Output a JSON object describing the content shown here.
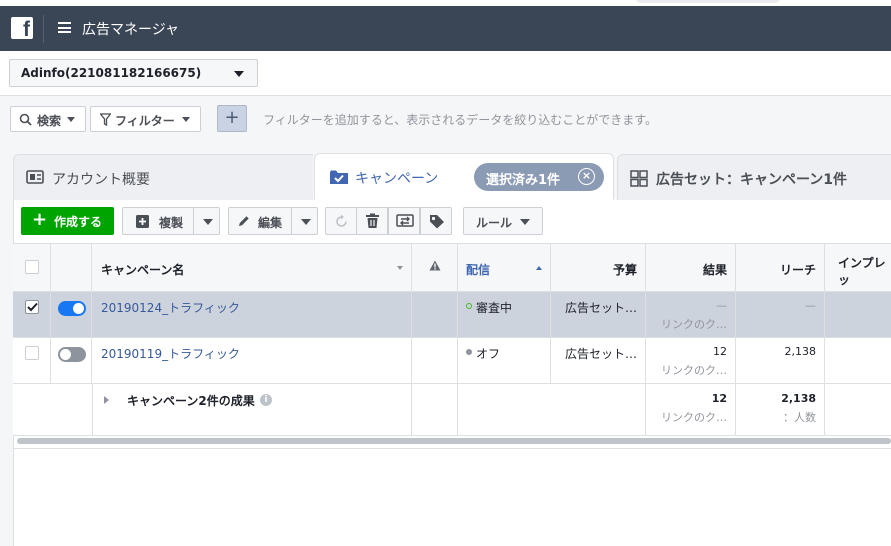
{
  "app": {
    "title": "広告マネージャ",
    "logo_letter": "f"
  },
  "account": {
    "name": "Adinfo(221081182166675)"
  },
  "filterbar": {
    "search_label": "検索",
    "filter_label": "フィルター",
    "hint": "フィルターを追加すると、表示されるデータを絞り込むことができます。"
  },
  "tabs": {
    "account": "アカウント概要",
    "campaign": "キャンペーン",
    "selected_pill": "選択済み1件",
    "adset": "広告セット：キャンペーン1件"
  },
  "toolbar": {
    "create": "作成する",
    "duplicate": "複製",
    "edit": "編集",
    "rules": "ルール"
  },
  "table": {
    "headers": {
      "name": "キャンペーン名",
      "delivery": "配信",
      "budget": "予算",
      "results": "結果",
      "reach": "リーチ",
      "impressions": "インプレッ"
    },
    "rows": [
      {
        "name": "20190124_トラフィック",
        "delivery": "審査中",
        "budget": "広告セット…",
        "results_value": "—",
        "results_sub": "リンクのク…",
        "reach": "—",
        "selected": true,
        "active": true
      },
      {
        "name": "20190119_トラフィック",
        "delivery": "オフ",
        "budget": "広告セット…",
        "results_value": "12",
        "results_sub": "リンクのク…",
        "reach": "2,138",
        "selected": false,
        "active": false
      }
    ],
    "summary": {
      "label": "キャンペーン2件の成果",
      "results_value": "12",
      "results_sub": "リンクのク…",
      "reach_value": "2,138",
      "reach_sub": "：人数"
    }
  },
  "colors": {
    "topbar": "#3a4656",
    "create_green": "#00a400",
    "accent_blue": "#4267b2",
    "toggle_on": "#1877f2",
    "toggle_off": "#8d949e"
  }
}
